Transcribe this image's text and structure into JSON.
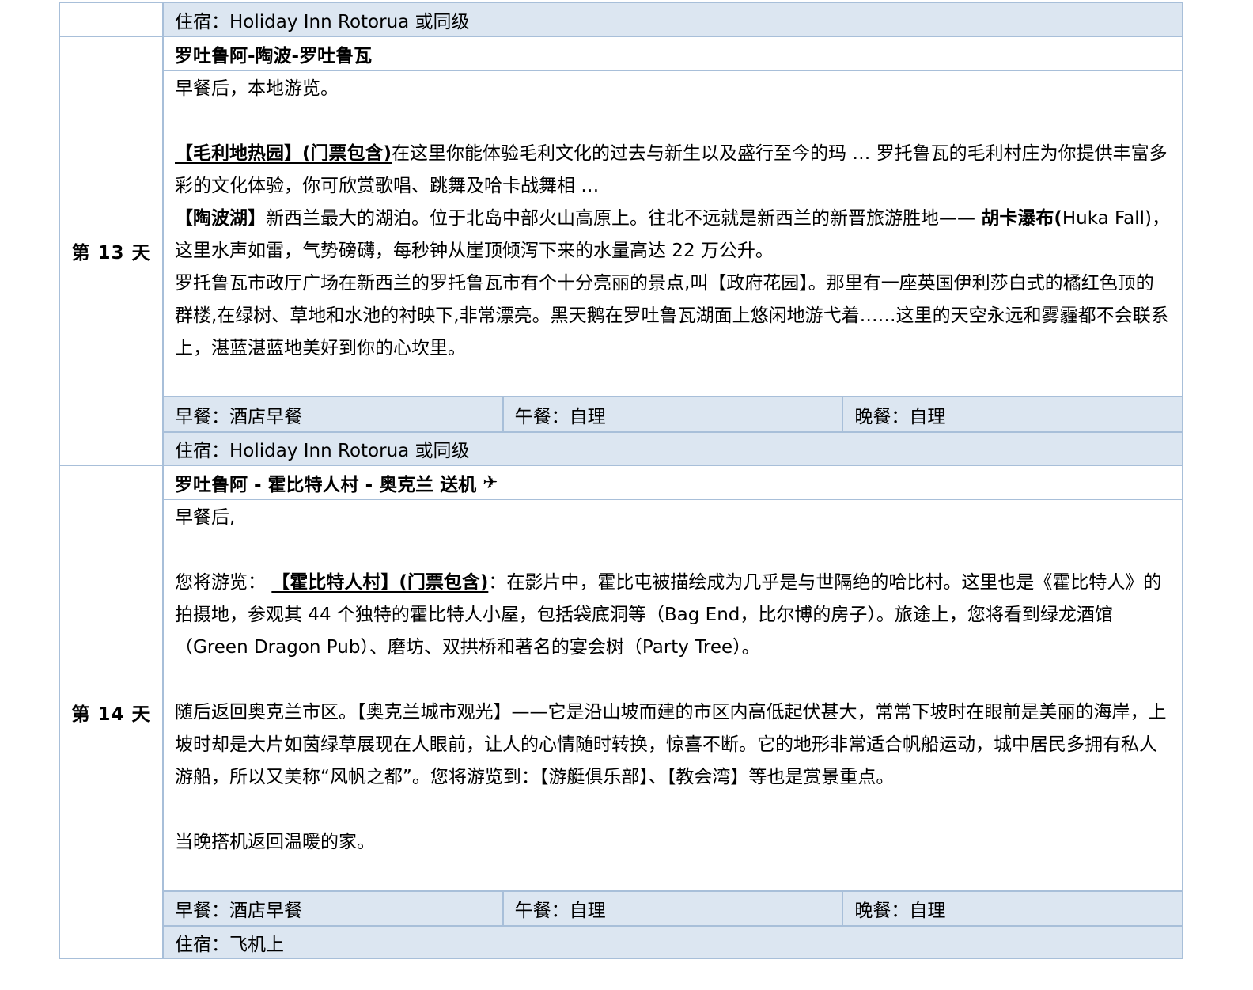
{
  "top_lodging": "住宿：Holiday Inn Rotorua 或同级",
  "days": [
    {
      "day_label": "第 13 天",
      "route_title": "罗吐鲁阿-陶波-罗吐鲁瓦",
      "intro": "早餐后，本地游览。",
      "sections": {
        "maori_title": "【毛利地热园】(门票包含)",
        "maori_text": "在这里你能体验毛利文化的过去与新生以及盛行至今的玛 … 罗托鲁瓦的毛利村庄为你提供丰富多彩的文化体验，你可欣赏歌唱、跳舞及哈卡战舞相 …",
        "taupo_title": "【陶波湖】",
        "taupo_text": "新西兰最大的湖泊。位于北岛中部火山高原上。往北不远就是新西兰的新晋旅游胜地——",
        "huka_title": "胡卡瀑布(",
        "huka_name": "Huka Fall)，",
        "huka_text": "这里水声如雷，气势磅礴，每秒钟从崖顶倾泻下来的水量高达 22 万公升。",
        "garden_text": "罗托鲁瓦市政厅广场在新西兰的罗托鲁瓦市有个十分亮丽的景点,叫【政府花园】。那里有一座英国伊利莎白式的橘红色顶的群楼,在绿树、草地和水池的衬映下,非常漂亮。黑天鹅在罗吐鲁瓦湖面上悠闲地游弋着……这里的天空永远和雾霾都不会联系上，湛蓝湛蓝地美好到你的心坎里。"
      },
      "meals": {
        "breakfast": "早餐：酒店早餐",
        "lunch": "午餐：自理",
        "dinner": "晚餐：自理"
      },
      "lodging": "住宿：Holiday Inn Rotorua 或同级"
    },
    {
      "day_label": "第 14 天",
      "route_title": "罗吐鲁阿 - 霍比特人村 - 奥克兰 送机",
      "route_icon": "✈",
      "intro": "早餐后,",
      "sections": {
        "hobbit_lead": "您将游览：",
        "hobbit_title": "【霍比特人村】(门票包含)",
        "hobbit_text": "：在影片中，霍比屯被描绘成为几乎是与世隔绝的哈比村。这里也是《霍比特人》的拍摄地，参观其 44 个独特的霍比特人小屋，包括袋底洞等（Bag End，比尔博的房子）。旅途上，您将看到绿龙酒馆（Green Dragon Pub）、磨坊、双拱桥和著名的宴会树（Party Tree）。",
        "auckland_text": "随后返回奥克兰市区。【奥克兰城市观光】——它是沿山坡而建的市区内高低起伏甚大，常常下坡时在眼前是美丽的海岸，上坡时却是大片如茵绿草展现在人眼前，让人的心情随时转换，惊喜不断。它的地形非常适合帆船运动，城中居民多拥有私人游船，所以又美称“风帆之都”。您将游览到：【游艇俱乐部】、【教会湾】等也是赏景重点。",
        "return_text": "当晚搭机返回温暖的家。"
      },
      "meals": {
        "breakfast": "早餐：酒店早餐",
        "lunch": "午餐：自理",
        "dinner": "晚餐：自理"
      },
      "lodging": "住宿：飞机上"
    }
  ],
  "colors": {
    "border": "#a8bfd9",
    "row_fill": "#dce6f1"
  }
}
